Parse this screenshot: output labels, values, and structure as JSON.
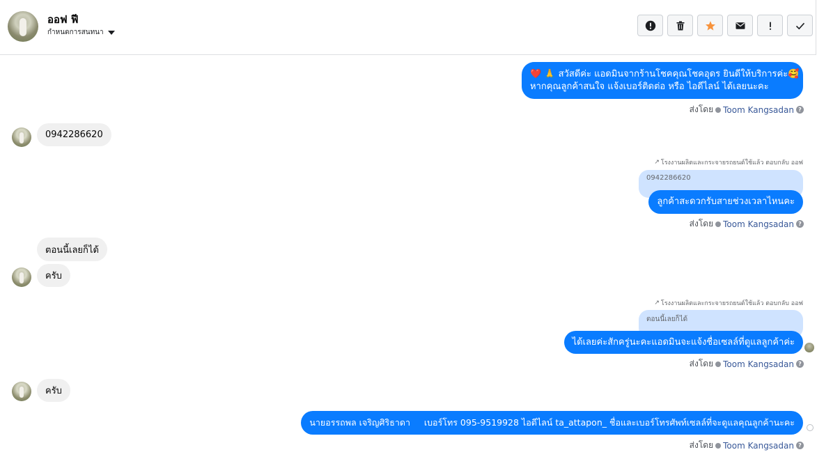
{
  "header": {
    "contact_name": "ออฟ ฟี",
    "subtitle": "กำหนดการสนทนา",
    "toolbar": [
      {
        "name": "alert-circle-button",
        "icon": "alert-circle-icon"
      },
      {
        "name": "delete-button",
        "icon": "trash-icon"
      },
      {
        "name": "star-button",
        "icon": "star-icon",
        "color": "#f7923b"
      },
      {
        "name": "mail-button",
        "icon": "envelope-icon"
      },
      {
        "name": "important-button",
        "icon": "exclamation-icon"
      },
      {
        "name": "done-button",
        "icon": "check-icon"
      }
    ]
  },
  "messages": {
    "m1": {
      "line1_heart": "❤️",
      "line1_hands": "🙏",
      "line1_text": "สวัสดีค่ะ แอดมินจากร้านโชคคุณโชคอุดร ยินดีให้บริการค่ะ",
      "line1_emoji": "🥰",
      "line2": "หากคุณลูกค้าสนใจ แจ้งเบอร์ติดต่อ หรือ ไอดีไลน์ ได้เลยนะคะ"
    },
    "m2": {
      "text": "0942286620"
    },
    "m3": {
      "reply_context": "โรงงานผลิตและกระจายรถยนต์ใช้แล้ว ตอบกลับ ออฟ",
      "quoted": "0942286620",
      "text": "ลูกค้าสะดวกรับสายช่วงเวลาไหนคะ"
    },
    "m4": {
      "text": "ตอนนี้เลยก็ได้"
    },
    "m5": {
      "text": "ครับ"
    },
    "m6": {
      "reply_context": "โรงงานผลิตและกระจายรถยนต์ใช้แล้ว ตอบกลับ ออฟ",
      "quoted": "ตอนนี้เลยก็ได้",
      "text": "ได้เลยค่ะสักครู่นะคะแอดมินจะแจ้งชื่อเซลล์ที่ดูแลลูกค้าค่ะ"
    },
    "m7": {
      "text": "ครับ"
    },
    "m8": {
      "text": "นายอรรถพล เจริญศิริธาดา     เบอร์โทร 095-9519928 ไอดีไลน์ ta_attapon_ ชื่อและเบอร์โทรศัพท์เซลล์ที่จะดูแลคุณลูกค้านะคะ"
    }
  },
  "sent_by": {
    "label": "ส่งโดย",
    "agent": "Toom Kangsadan",
    "help": "?"
  },
  "colors": {
    "outgoing_bubble": "#0a7cff",
    "incoming_bubble": "#f0f0f0",
    "quoted_bubble": "#cfe3ff",
    "agent_link": "#385898"
  }
}
